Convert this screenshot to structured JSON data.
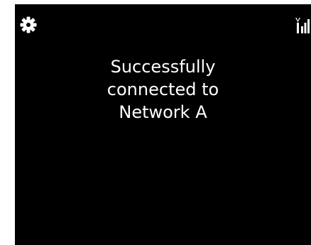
{
  "status_bar": {
    "left_icon": "gear-icon",
    "right_icon": "signal-strength-icon"
  },
  "message": {
    "line1": "Successfully",
    "line2": "connected to",
    "line3": "Network A"
  },
  "colors": {
    "background": "#000000",
    "text": "#ffffff"
  }
}
